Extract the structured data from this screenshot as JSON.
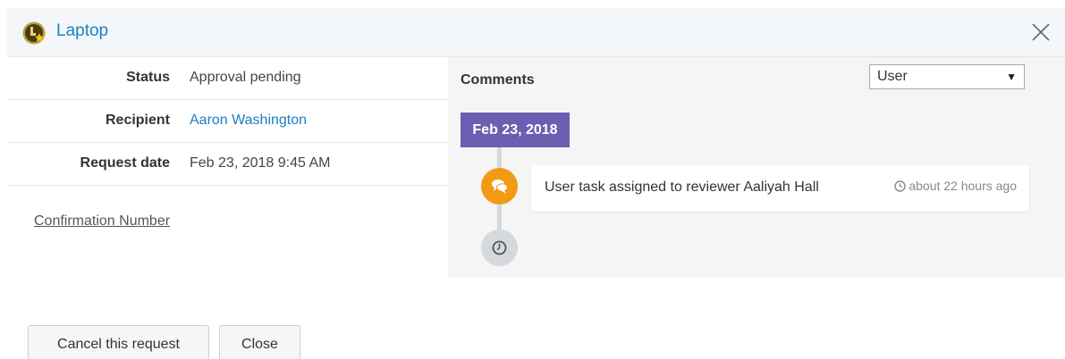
{
  "header": {
    "title": "Laptop",
    "app_icon": "laptop-badge-icon",
    "close_icon": "close-icon"
  },
  "details": {
    "status": {
      "label": "Status",
      "value": "Approval pending"
    },
    "recipient": {
      "label": "Recipient",
      "value": "Aaron Washington"
    },
    "request_date": {
      "label": "Request date",
      "value": "Feb 23, 2018 9:45 AM"
    }
  },
  "confirmation_link": "Confirmation Number",
  "comments": {
    "heading": "Comments",
    "filter": {
      "selected": "User"
    },
    "date_badge": "Feb 23, 2018",
    "items": [
      {
        "text": "User task assigned to reviewer Aaliyah Hall",
        "time": "about 22 hours ago",
        "icon": "chat-icon"
      }
    ],
    "end_icon": "clock-icon"
  },
  "buttons": {
    "cancel": "Cancel this request",
    "close": "Close"
  },
  "colors": {
    "accent": "#1a7fc3",
    "badge": "#6a5fb0",
    "comment_node": "#f39a14"
  }
}
